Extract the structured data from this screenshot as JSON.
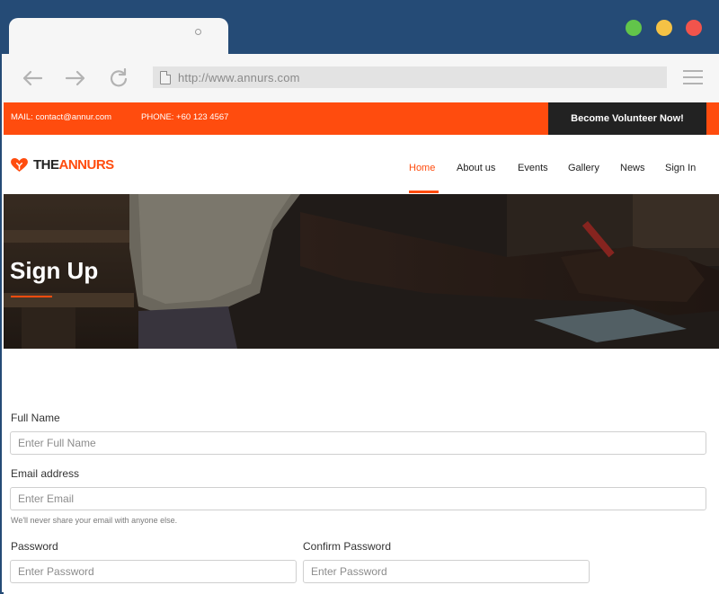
{
  "browser": {
    "url": "http://www.annurs.com",
    "icons": {
      "back": "arrow-left-icon",
      "forward": "arrow-right-icon",
      "reload": "reload-icon",
      "page": "page-icon",
      "menu": "hamburger-menu-icon"
    },
    "window_buttons": [
      "#62c54a",
      "#f5c245",
      "#f2544c"
    ]
  },
  "topbar": {
    "mail": "MAIL: contact@annur.com",
    "phone": "PHONE: +60 123 4567",
    "cta": "Become Volunteer Now!"
  },
  "brand": {
    "prefix": "THE",
    "name": "ANNURS",
    "icon": "heart-hands-icon"
  },
  "nav": {
    "items": [
      {
        "label": "Home",
        "active": true
      },
      {
        "label": "About us",
        "active": false
      },
      {
        "label": "Events",
        "active": false
      },
      {
        "label": "Gallery",
        "active": false
      },
      {
        "label": "News",
        "active": false
      },
      {
        "label": "Sign In",
        "active": false
      }
    ]
  },
  "hero": {
    "title": "Sign Up"
  },
  "form": {
    "full_name_label": "Full Name",
    "full_name_placeholder": "Enter Full Name",
    "email_label": "Email address",
    "email_placeholder": "Enter Email",
    "email_help": "We'll never share your email with anyone else.",
    "password_label": "Password",
    "password_placeholder": "Enter Password",
    "confirm_label": "Confirm Password",
    "confirm_placeholder": "Enter Password"
  },
  "colors": {
    "chrome": "#254b76",
    "accent": "#ff4c0e",
    "dark": "#222222"
  }
}
